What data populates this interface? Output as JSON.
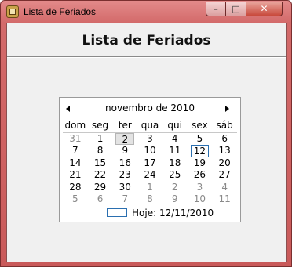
{
  "window": {
    "title": "Lista de Feriados",
    "buttons": {
      "minimize": "–",
      "maximize": "□",
      "close": "✕"
    }
  },
  "header": {
    "title": "Lista de Feriados"
  },
  "calendar": {
    "month_label": "novembro de 2010",
    "prev_icon": "left-arrow",
    "next_icon": "right-arrow",
    "weekdays": [
      "dom",
      "seg",
      "ter",
      "qua",
      "qui",
      "sex",
      "sáb"
    ],
    "weeks": [
      [
        "31",
        "1",
        "2",
        "3",
        "4",
        "5",
        "6"
      ],
      [
        "7",
        "8",
        "9",
        "10",
        "11",
        "12",
        "13"
      ],
      [
        "14",
        "15",
        "16",
        "17",
        "18",
        "19",
        "20"
      ],
      [
        "21",
        "22",
        "23",
        "24",
        "25",
        "26",
        "27"
      ],
      [
        "28",
        "29",
        "30",
        "1",
        "2",
        "3",
        "4"
      ],
      [
        "5",
        "6",
        "7",
        "8",
        "9",
        "10",
        "11"
      ]
    ],
    "selected_day": "2",
    "today_day": "12",
    "today_label": "Hoje: 12/11/2010"
  }
}
